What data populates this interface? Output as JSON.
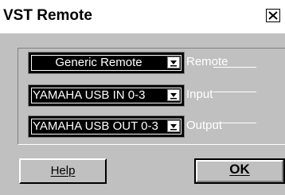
{
  "window": {
    "title": "VST Remote",
    "close_icon": "close-icon"
  },
  "rows": [
    {
      "name": "remote",
      "selected_value": "Generic Remote",
      "label": "Remote",
      "arrow_icon": "dropdown-arrow-icon"
    },
    {
      "name": "input",
      "selected_value": "YAMAHA USB IN 0-3",
      "label": "Input",
      "arrow_icon": "dropdown-arrow-icon"
    },
    {
      "name": "output",
      "selected_value": "YAMAHA USB OUT 0-3",
      "label": "Output",
      "arrow_icon": "dropdown-arrow-icon"
    }
  ],
  "buttons": {
    "help_label": "Help",
    "ok_label": "OK"
  },
  "colors": {
    "dialog_background": "#c0c0c0",
    "titlebar_background": "#ffffff",
    "dropdown_background": "#000000",
    "dropdown_text": "#ffffff",
    "label_text": "#ffffff"
  }
}
